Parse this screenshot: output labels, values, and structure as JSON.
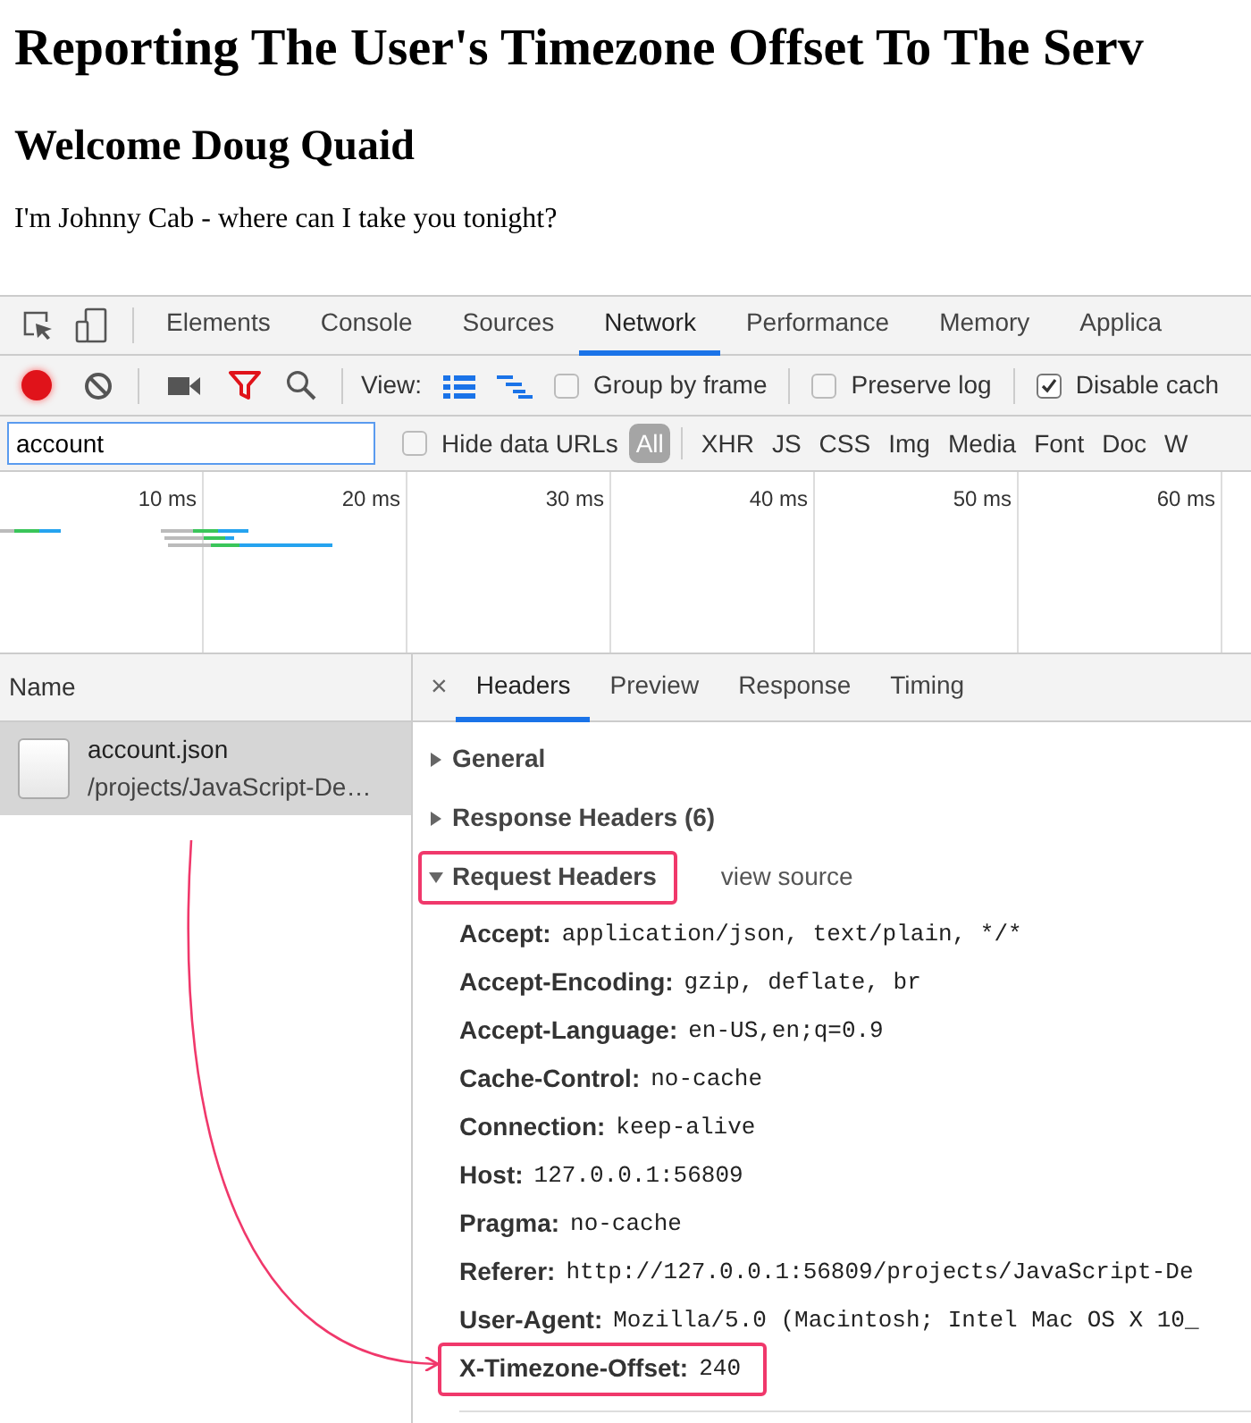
{
  "page": {
    "title": "Reporting The User's Timezone Offset To The Serv",
    "heading": "Welcome Doug Quaid",
    "text": "I'm Johnny Cab - where can I take you tonight?"
  },
  "devtools": {
    "tabs": [
      {
        "label": "Elements",
        "selected": false
      },
      {
        "label": "Console",
        "selected": false
      },
      {
        "label": "Sources",
        "selected": false
      },
      {
        "label": "Network",
        "selected": true
      },
      {
        "label": "Performance",
        "selected": false
      },
      {
        "label": "Memory",
        "selected": false
      },
      {
        "label": "Applica",
        "selected": false
      }
    ],
    "toolbar": {
      "recording": true,
      "filter_active": true,
      "view_label": "View:",
      "view_toggles": [
        {
          "kind": "rows",
          "on": true
        },
        {
          "kind": "overview",
          "on": true
        }
      ],
      "checkboxes": [
        {
          "label": "Group by frame",
          "checked": false
        },
        {
          "label": "Preserve log",
          "checked": false
        },
        {
          "label": "Disable cach",
          "checked": true
        }
      ]
    },
    "filter": {
      "value": "account",
      "hide_data_urls": {
        "label": "Hide data URLs",
        "checked": false
      },
      "types": [
        {
          "label": "All",
          "selected": true
        },
        {
          "label": "XHR",
          "selected": false
        },
        {
          "label": "JS",
          "selected": false
        },
        {
          "label": "CSS",
          "selected": false
        },
        {
          "label": "Img",
          "selected": false
        },
        {
          "label": "Media",
          "selected": false
        },
        {
          "label": "Font",
          "selected": false
        },
        {
          "label": "Doc",
          "selected": false
        },
        {
          "label": "W",
          "selected": false
        }
      ]
    },
    "timeline": {
      "ticks": [
        "10 ms",
        "20 ms",
        "30 ms",
        "40 ms",
        "50 ms",
        "60 ms"
      ]
    },
    "requests": {
      "column": "Name",
      "rows": [
        {
          "name": "account.json",
          "path": "/projects/JavaScript-De…",
          "selected": true
        }
      ]
    },
    "detail": {
      "close": "×",
      "tabs": [
        {
          "label": "Headers",
          "selected": true
        },
        {
          "label": "Preview",
          "selected": false
        },
        {
          "label": "Response",
          "selected": false
        },
        {
          "label": "Timing",
          "selected": false
        }
      ],
      "sections": [
        {
          "title": "General",
          "expanded": false,
          "highlighted": false
        },
        {
          "title": "Response Headers (6)",
          "expanded": false,
          "highlighted": false
        },
        {
          "title": "Request Headers",
          "expanded": true,
          "highlighted": true,
          "link": "view source",
          "headers": [
            {
              "name": "Accept:",
              "value": "application/json, text/plain, */*",
              "highlighted": false
            },
            {
              "name": "Accept-Encoding:",
              "value": "gzip, deflate, br",
              "highlighted": false
            },
            {
              "name": "Accept-Language:",
              "value": "en-US,en;q=0.9",
              "highlighted": false
            },
            {
              "name": "Cache-Control:",
              "value": "no-cache",
              "highlighted": false
            },
            {
              "name": "Connection:",
              "value": "keep-alive",
              "highlighted": false
            },
            {
              "name": "Host:",
              "value": "127.0.0.1:56809",
              "highlighted": false
            },
            {
              "name": "Pragma:",
              "value": "no-cache",
              "highlighted": false
            },
            {
              "name": "Referer:",
              "value": "http://127.0.0.1:56809/projects/JavaScript-De",
              "highlighted": false
            },
            {
              "name": "User-Agent:",
              "value": "Mozilla/5.0 (Macintosh; Intel Mac OS X 10_",
              "highlighted": false
            },
            {
              "name": "X-Timezone-Offset:",
              "value": "240",
              "highlighted": true
            }
          ]
        }
      ]
    }
  }
}
